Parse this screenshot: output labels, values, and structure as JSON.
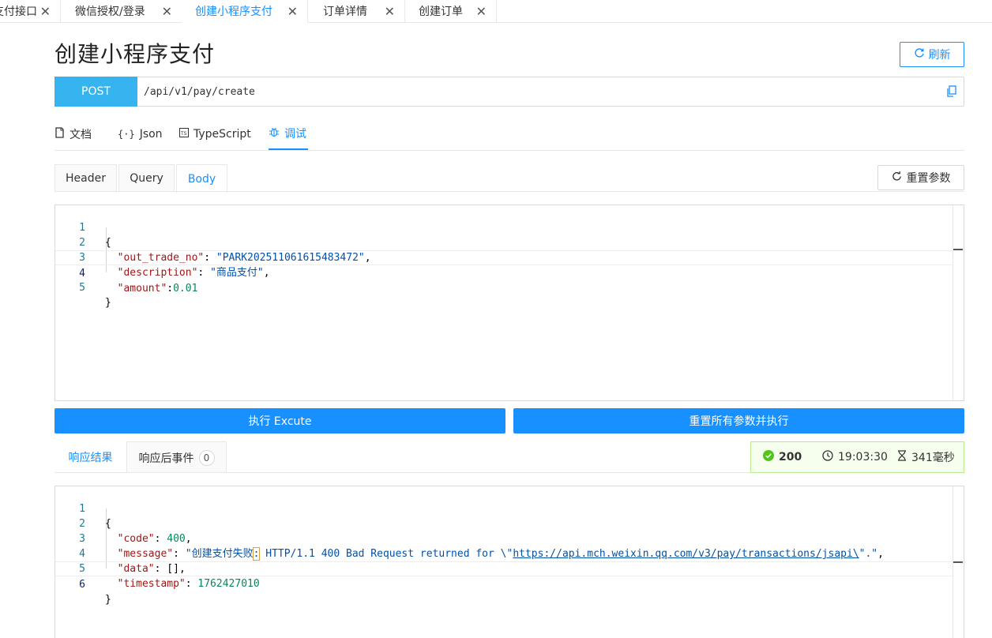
{
  "top_tabs": [
    {
      "label": "支付接口",
      "close": "✕"
    },
    {
      "label": "微信授权/登录",
      "close": "✕"
    },
    {
      "label": "创建小程序支付",
      "close": "✕"
    },
    {
      "label": "订单详情",
      "close": "✕"
    },
    {
      "label": "创建订单",
      "close": "✕"
    }
  ],
  "page": {
    "title": "创建小程序支付",
    "refresh_label": "刷新"
  },
  "request": {
    "method": "POST",
    "url": "/api/v1/pay/create"
  },
  "view_tabs": [
    {
      "label": "文档"
    },
    {
      "label": "Json"
    },
    {
      "label": "TypeScript"
    },
    {
      "label": "调试"
    }
  ],
  "param_tabs": [
    {
      "label": "Header"
    },
    {
      "label": "Query"
    },
    {
      "label": "Body"
    }
  ],
  "reset_params_label": "重置参数",
  "request_body": {
    "line_numbers": [
      "1",
      "2",
      "3",
      "4",
      "5"
    ],
    "open_brace": "{",
    "close_brace": "}",
    "out_trade_no_key": "\"out_trade_no\"",
    "out_trade_no_value": "\"PARK202511061615483472\"",
    "description_key": "\"description\"",
    "description_value": "\"商品支付\"",
    "amount_key": "\"amount\"",
    "amount_value": "0.01"
  },
  "buttons": {
    "execute": "执行 Excute",
    "reset_execute": "重置所有参数并执行"
  },
  "response_tabs": {
    "result": "响应结果",
    "events": "响应后事件",
    "events_count": "0"
  },
  "status": {
    "code": "200",
    "time": "19:03:30",
    "duration": "341毫秒",
    "ok_color": "#52c41a"
  },
  "response_body": {
    "line_numbers": [
      "1",
      "2",
      "3",
      "4",
      "5",
      "6"
    ],
    "open_brace": "{",
    "close_brace": "}",
    "code_key": "\"code\"",
    "code_value": "400",
    "message_key": "\"message\"",
    "message_prefix": "\"创建支付失败",
    "message_colon": ":",
    "message_middle": " HTTP/1.1 400 Bad Request returned for \\\"",
    "message_link": "https://api.mch.weixin.qq.com/v3/pay/transactions/jsapi\\",
    "message_suffix": "\".\"",
    "data_key": "\"data\"",
    "data_value": "[]",
    "timestamp_key": "\"timestamp\"",
    "timestamp_value": "1762427010"
  }
}
